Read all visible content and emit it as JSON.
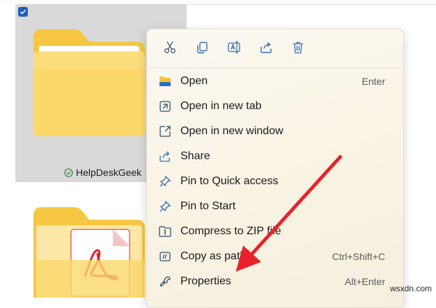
{
  "folders": [
    {
      "label": "HelpDeskGeek",
      "selected": true,
      "status_icon": "sync-ok-icon"
    },
    {
      "label": "",
      "selected": false,
      "overlay_icon": "pdf-icon"
    }
  ],
  "context_menu": {
    "toolbar": [
      {
        "name": "cut-icon"
      },
      {
        "name": "copy-icon"
      },
      {
        "name": "rename-icon"
      },
      {
        "name": "share-icon"
      },
      {
        "name": "delete-icon"
      }
    ],
    "items": [
      {
        "label": "Open",
        "accelerator": "Enter",
        "icon": "folder-icon"
      },
      {
        "label": "Open in new tab",
        "accelerator": "",
        "icon": "new-tab-icon"
      },
      {
        "label": "Open in new window",
        "accelerator": "",
        "icon": "new-window-icon"
      },
      {
        "label": "Share",
        "accelerator": "",
        "icon": "share-icon"
      },
      {
        "label": "Pin to Quick access",
        "accelerator": "",
        "icon": "pin-icon"
      },
      {
        "label": "Pin to Start",
        "accelerator": "",
        "icon": "pin-icon"
      },
      {
        "label": "Compress to ZIP file",
        "accelerator": "",
        "icon": "zip-icon"
      },
      {
        "label": "Copy as path",
        "accelerator": "Ctrl+Shift+C",
        "icon": "copy-path-icon"
      },
      {
        "label": "Properties",
        "accelerator": "Alt+Enter",
        "icon": "wrench-icon"
      }
    ]
  },
  "annotation": {
    "arrow_color": "#e8222a",
    "target": "Properties"
  },
  "watermark": "wsxdn.com"
}
